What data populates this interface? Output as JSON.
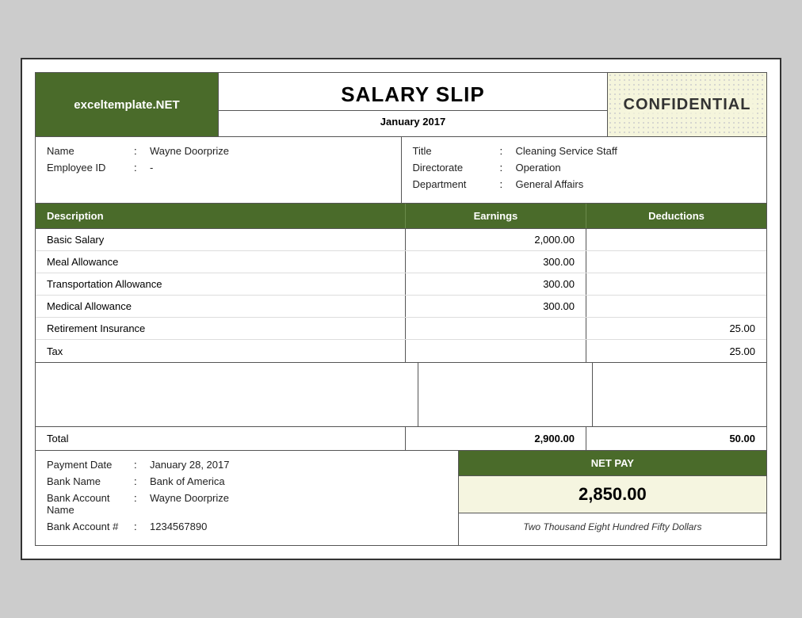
{
  "header": {
    "logo": "exceltemplate.NET",
    "title": "SALARY SLIP",
    "date": "January 2017",
    "confidential": "CONFIDENTIAL"
  },
  "employee": {
    "name_label": "Name",
    "name_value": "Wayne Doorprize",
    "id_label": "Employee ID",
    "id_value": "-",
    "title_label": "Title",
    "title_value": "Cleaning Service Staff",
    "directorate_label": "Directorate",
    "directorate_value": "Operation",
    "department_label": "Department",
    "department_value": "General Affairs",
    "colon": ":"
  },
  "table": {
    "col_desc": "Description",
    "col_earnings": "Earnings",
    "col_deductions": "Deductions",
    "rows": [
      {
        "desc": "Basic Salary",
        "earnings": "2,000.00",
        "deductions": ""
      },
      {
        "desc": "Meal Allowance",
        "earnings": "300.00",
        "deductions": ""
      },
      {
        "desc": "Transportation Allowance",
        "earnings": "300.00",
        "deductions": ""
      },
      {
        "desc": "Medical Allowance",
        "earnings": "300.00",
        "deductions": ""
      },
      {
        "desc": "Retirement Insurance",
        "earnings": "",
        "deductions": "25.00"
      },
      {
        "desc": "Tax",
        "earnings": "",
        "deductions": "25.00"
      }
    ],
    "total_label": "Total",
    "total_earnings": "2,900.00",
    "total_deductions": "50.00"
  },
  "payment": {
    "date_label": "Payment Date",
    "date_value": "January 28, 2017",
    "bank_label": "Bank Name",
    "bank_value": "Bank of America",
    "account_name_label": "Bank Account Name",
    "account_name_value": "Wayne Doorprize",
    "account_num_label": "Bank Account #",
    "account_num_value": "1234567890",
    "net_pay_header": "NET PAY",
    "net_pay_amount": "2,850.00",
    "net_pay_words": "Two Thousand Eight Hundred Fifty Dollars"
  }
}
